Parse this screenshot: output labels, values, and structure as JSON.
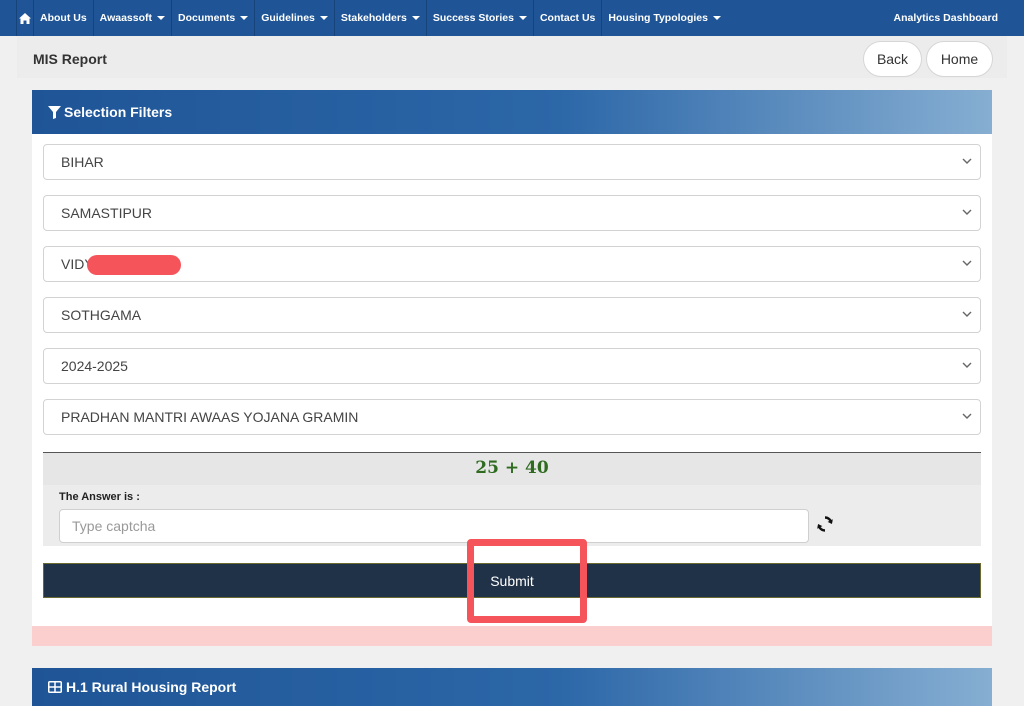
{
  "nav": {
    "items": [
      {
        "label": "About Us",
        "dropdown": false
      },
      {
        "label": "Awaassoft",
        "dropdown": true
      },
      {
        "label": "Documents",
        "dropdown": true
      },
      {
        "label": "Guidelines",
        "dropdown": true
      },
      {
        "label": "Stakeholders",
        "dropdown": true
      },
      {
        "label": "Success Stories",
        "dropdown": true
      },
      {
        "label": "Contact Us",
        "dropdown": false
      },
      {
        "label": "Housing Typologies",
        "dropdown": true
      }
    ],
    "right_label": "Analytics Dashboard"
  },
  "header": {
    "title": "MIS Report",
    "back_label": "Back",
    "home_label": "Home"
  },
  "filters": {
    "title": "Selection Filters",
    "state": "BIHAR",
    "district": "SAMASTIPUR",
    "block": "VIDY           R",
    "panchayat": "SOTHGAMA",
    "year": "2024-2025",
    "scheme": "PRADHAN MANTRI AWAAS YOJANA GRAMIN"
  },
  "captcha": {
    "equation": "25 + 40",
    "answer_label": "The Answer is :",
    "placeholder": "Type captcha",
    "value": ""
  },
  "submit_label": "Submit",
  "report": {
    "title": "H.1 Rural Housing Report"
  },
  "colors": {
    "nav_bg": "#1f5597",
    "submit_bg": "#203248",
    "highlight": "#f4545a",
    "captcha_text": "#2e6b20"
  }
}
